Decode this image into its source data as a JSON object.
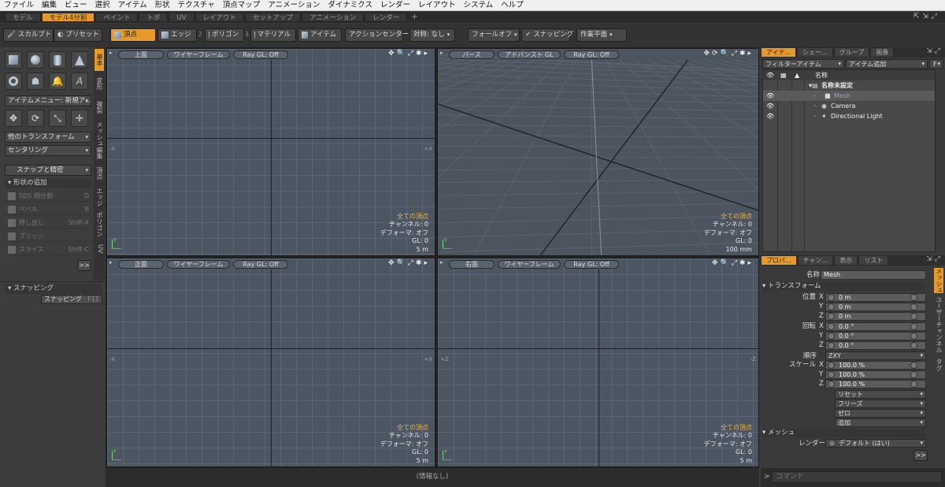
{
  "menubar": [
    "ファイル",
    "編集",
    "ビュー",
    "選択",
    "アイテム",
    "形状",
    "テクスチャ",
    "頂点マップ",
    "アニメーション",
    "ダイナミクス",
    "レンダー",
    "レイアウト",
    "システム",
    "ヘルプ"
  ],
  "layout_tabs": [
    {
      "label": "モデル",
      "active": false
    },
    {
      "label": "モデル4分割",
      "active": true
    },
    {
      "label": "ペイント",
      "active": false
    },
    {
      "label": "トポ",
      "active": false
    },
    {
      "label": "UV",
      "active": false
    },
    {
      "label": "レイアウト",
      "active": false
    },
    {
      "label": "セットアップ",
      "active": false
    },
    {
      "label": "アニメーション",
      "active": false
    },
    {
      "label": "レンダー",
      "active": false
    },
    {
      "label": "+",
      "active": false
    }
  ],
  "toolbar": {
    "sculpt": "スカルプト",
    "preset": "プリセット",
    "vertex": "頂点",
    "vertex_key": "1",
    "edge": "エッジ",
    "edge_key": "2",
    "polygon": "ポリゴン",
    "polygon_key": "3",
    "material": "マテリアル",
    "item": "アイテム",
    "action_center": "アクションセンター",
    "symmetry": "対称: なし",
    "falloff": "フォールオフ",
    "snapping": "スナッピング",
    "work_plane": "作業平面"
  },
  "leftpanel": {
    "item_menu": "アイテムメニュー: 新規ア...",
    "transform": "他のトランスフォーム",
    "centering": "センタリング",
    "snap_precise": "スナップと精密",
    "add_shape": "形状の追加",
    "items": [
      {
        "label": "SDS 細分割",
        "key": "D"
      },
      {
        "label": "ベベル",
        "key": "B"
      },
      {
        "label": "押し出し",
        "key": "Shift-X"
      },
      {
        "label": "ブリッジ",
        "key": ""
      },
      {
        "label": "スライス",
        "key": "Shift-C"
      }
    ],
    "more": ">>",
    "snapping_section": "スナッピング",
    "snapping_btn": "スナッピング",
    "snapping_key": "F11"
  },
  "vtabs": [
    "基本",
    "変形",
    "複製",
    "メッシュ編集",
    "頂点",
    "エッジ",
    "ポリゴン",
    "UV"
  ],
  "viewports": {
    "tl": {
      "view": "上面",
      "shading": "ワイヤーフレーム",
      "raygl": "Ray GL: Off",
      "info": {
        "sel": "全ての頂点",
        "channel": "チャンネル: 0",
        "deformer": "デフォーマ: オフ",
        "gl": "GL: 0",
        "scale": "5 m"
      },
      "lx": "-X",
      "rx": "+X"
    },
    "tr": {
      "view": "パース",
      "shading": "アドバンスト GL",
      "raygl": "Ray GL: Off",
      "info": {
        "sel": "全ての頂点",
        "channel": "チャンネル: 0",
        "deformer": "デフォーマ: オフ",
        "gl": "GL: 0",
        "scale": "100 mm"
      }
    },
    "bl": {
      "view": "正面",
      "shading": "ワイヤーフレーム",
      "raygl": "Ray GL: Off",
      "info": {
        "sel": "全ての頂点",
        "channel": "チャンネル: 0",
        "deformer": "デフォーマ: オフ",
        "gl": "GL: 0",
        "scale": "5 m"
      },
      "lx": "-X",
      "rx": "+X"
    },
    "br": {
      "view": "右面",
      "shading": "ワイヤーフレーム",
      "raygl": "Ray GL: Off",
      "info": {
        "sel": "全ての頂点",
        "channel": "チャンネル: 0",
        "deformer": "デフォーマ: オフ",
        "gl": "GL: 0",
        "scale": "5 m"
      },
      "lx": "+Z",
      "rx": "-Z"
    }
  },
  "statusbar": "(情報なし)",
  "items_panel": {
    "tabs": [
      "アイテ...",
      "シェー...",
      "グループ",
      "画像"
    ],
    "filter": "フィルターアイテム",
    "add": "アイテム追加",
    "f": "F",
    "col_name": "名称",
    "rows": [
      {
        "label": "名称未設定",
        "bold": true
      },
      {
        "label": "Mesh",
        "bold": false
      },
      {
        "label": "Camera",
        "bold": false
      },
      {
        "label": "Directional Light",
        "bold": false
      }
    ]
  },
  "props_panel": {
    "tabs": [
      "プロパ...",
      "チャン...",
      "表示",
      "リスト"
    ],
    "side_tabs": [
      "メッシュ",
      "ユーザーチャンネル",
      "タグ"
    ],
    "name_label": "名称",
    "name_value": "Mesh",
    "transform": "トランスフォーム",
    "pos_label": "位置",
    "rot_label": "回転",
    "order_label": "順序",
    "order_value": "ZXY",
    "scale_label": "スケール",
    "pos": [
      {
        "axis": "X",
        "v": "0 m"
      },
      {
        "axis": "Y",
        "v": "0 m"
      },
      {
        "axis": "Z",
        "v": "0 m"
      }
    ],
    "rot": [
      {
        "axis": "X",
        "v": "0.0 °"
      },
      {
        "axis": "Y",
        "v": "0.0 °"
      },
      {
        "axis": "Z",
        "v": "0.0 °"
      }
    ],
    "scale": [
      {
        "axis": "X",
        "v": "100.0 %"
      },
      {
        "axis": "Y",
        "v": "100.0 %"
      },
      {
        "axis": "Z",
        "v": "100.0 %"
      }
    ],
    "reset": "リセット",
    "freeze": "フリーズ",
    "zero": "ゼロ",
    "add": "追加",
    "mesh": "メッシュ",
    "render_label": "レンダー",
    "render_value": "デフォルト (はい)",
    "more": ">>"
  },
  "command": "コマンド"
}
